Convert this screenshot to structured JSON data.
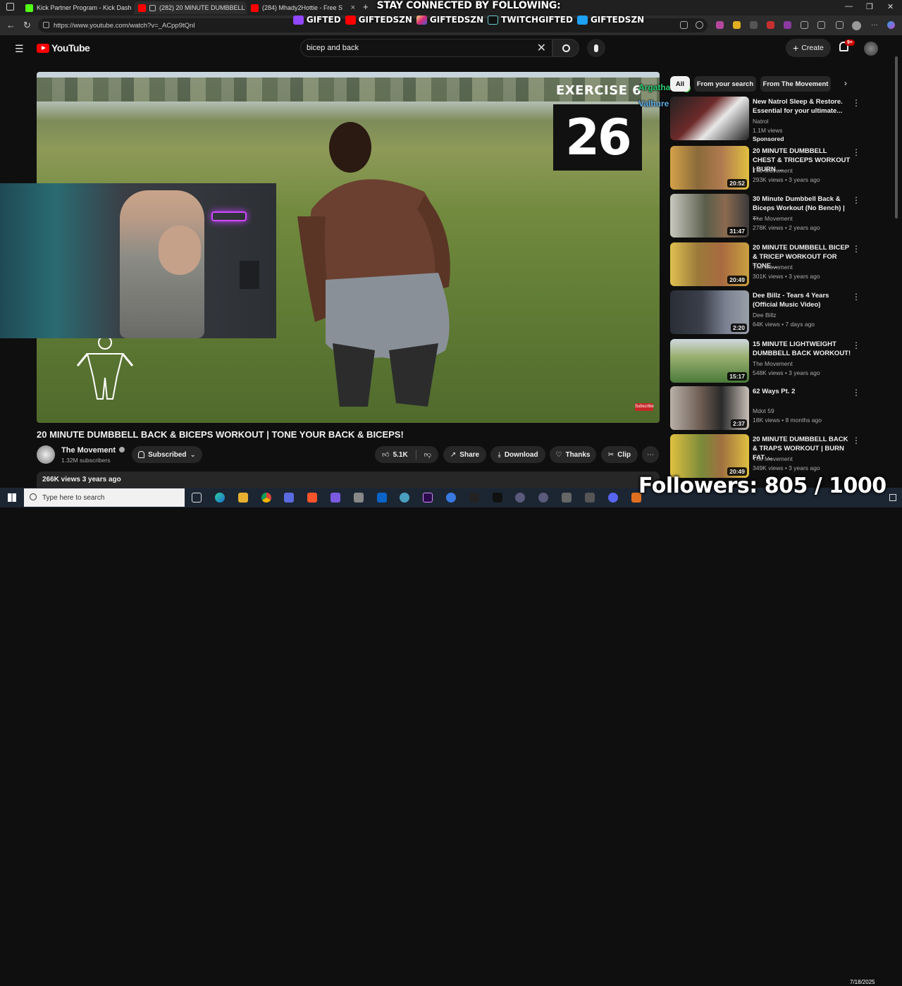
{
  "browser": {
    "tabs": [
      {
        "label": "Kick Partner Program - Kick Dash",
        "color": "#53fc18",
        "active": false
      },
      {
        "label": "(282) 20 MINUTE DUMBBELL",
        "color": "#ff0000",
        "active": true
      },
      {
        "label": "(284) Mhady2Hottie - Free S",
        "color": "#ff0000",
        "active": false
      }
    ],
    "new_tab": "+",
    "url": "https://www.youtube.com/watch?v=_ACpp9tQnI"
  },
  "overlay": {
    "social_heading": "STAY CONNECTED BY FOLLOWING:",
    "socials": [
      {
        "label": "GIFTED",
        "icon": "twitch-icon",
        "color": "#9146ff"
      },
      {
        "label": "GIFTEDSZN",
        "icon": "youtube-icon",
        "color": "#ff0000"
      },
      {
        "label": "GIFTEDSZN",
        "icon": "instagram-icon",
        "color": "#d6249f"
      },
      {
        "label": "TWITCHGIFTED",
        "icon": "tiktok-icon",
        "color": "#111111"
      },
      {
        "label": "GIFTEDSZN",
        "icon": "twitter-icon",
        "color": "#1da1f2"
      }
    ],
    "chat": [
      {
        "user": "Argathas :",
        "color": "#2ecc71"
      },
      {
        "user": "Valhure :",
        "color": "#5dade2"
      }
    ],
    "followers": "Followers: 805 / 1000"
  },
  "youtube": {
    "logo": "YouTube",
    "search_value": "bicep and back",
    "create_label": "Create",
    "notification_count": "9+",
    "video": {
      "exercise_label": "EXERCISE 6",
      "timer": "26",
      "subscribe_badge": "Subscribe",
      "title": "20 MINUTE DUMBBELL BACK & BICEPS WORKOUT | TONE YOUR BACK & BICEPS!",
      "channel": "The Movement",
      "subscribers": "1.32M subscribers",
      "subscribed_label": "Subscribed",
      "likes": "5.1K",
      "share_label": "Share",
      "download_label": "Download",
      "thanks_label": "Thanks",
      "clip_label": "Clip",
      "views_line": "266K views  3 years ago"
    },
    "chips": [
      "All",
      "From your search",
      "From The Movement"
    ],
    "recommendations": [
      {
        "title": "New Natrol Sleep & Restore. Essential for your ultimate...",
        "channel": "Natrol",
        "meta": "1.1M views",
        "duration": "",
        "sponsored": "Sponsored",
        "thumb": "#6d2a2a"
      },
      {
        "title": "20 MINUTE DUMBBELL CHEST & TRICEPS WORKOUT | BURN ...",
        "channel": "The Movement",
        "meta": "293K views • 3 years ago",
        "duration": "20:52",
        "sponsored": "",
        "thumb": "#8a6a3a"
      },
      {
        "title": "30 Minute Dumbbell Back & Biceps Workout (No Bench) | ...",
        "channel": "The Movement",
        "meta": "278K views • 2 years ago",
        "duration": "31:47",
        "sponsored": "",
        "thumb": "#5a5d4a"
      },
      {
        "title": "20 MINUTE DUMBBELL BICEP & TRICEP WORKOUT FOR TONE...",
        "channel": "The Movement",
        "meta": "301K views • 3 years ago",
        "duration": "20:49",
        "sponsored": "",
        "thumb": "#9a7a3a"
      },
      {
        "title": "Dee Billz - Tears 4 Years (Official Music Video)",
        "channel": "Dee Billz",
        "meta": "64K views • 7 days ago",
        "duration": "2:20",
        "sponsored": "",
        "thumb": "#3a3f4a"
      },
      {
        "title": "15 MINUTE LIGHTWEIGHT DUMBBELL BACK WORKOUT!",
        "channel": "The Movement",
        "meta": "548K views • 3 years ago",
        "duration": "15:17",
        "sponsored": "",
        "thumb": "#4a7a3a"
      },
      {
        "title": "62 Ways Pt. 2",
        "channel": "Mdot 59",
        "meta": "18K views • 8 months ago",
        "duration": "2:37",
        "sponsored": "",
        "thumb": "#6a5a50"
      },
      {
        "title": "20 MINUTE DUMBBELL BACK & TRAPS WORKOUT | BURN FAT ...",
        "channel": "The Movement",
        "meta": "349K views • 3 years ago",
        "duration": "20:49",
        "sponsored": "",
        "thumb": "#7a8a3a"
      }
    ]
  },
  "taskbar": {
    "search_placeholder": "Type here to search",
    "clock_date": "7/18/2025"
  }
}
